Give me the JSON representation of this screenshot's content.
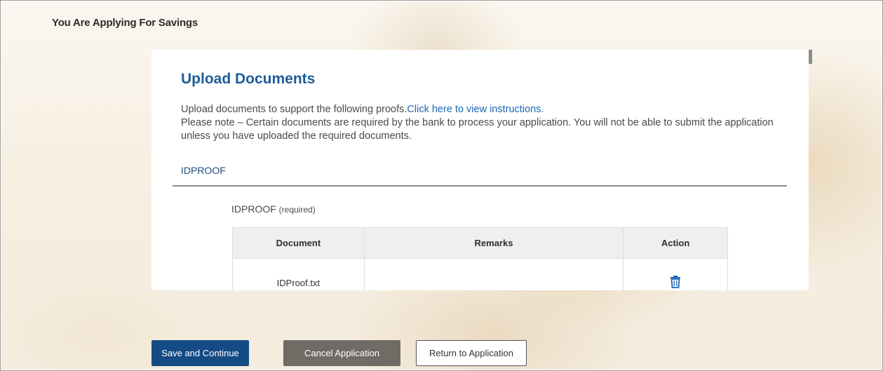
{
  "page": {
    "heading": "You Are Applying For Savings"
  },
  "upload": {
    "title": "Upload Documents",
    "intro_text": "Upload documents to support the following proofs.",
    "instructions_link": "Click here to view instructions.",
    "note": "Please note – Certain documents are required by the bank to process your application. You will not be able to submit the application unless you have uploaded the required documents."
  },
  "section": {
    "label": "IDPROOF",
    "proof_label": "IDPROOF",
    "required_tag": "(required)"
  },
  "table": {
    "headers": {
      "document": "Document",
      "remarks": "Remarks",
      "action": "Action"
    },
    "rows": [
      {
        "document": "IDProof.txt",
        "remarks": "",
        "action_icon": "trash-icon"
      }
    ]
  },
  "actions": {
    "save_continue": "Save and Continue",
    "cancel_application": "Cancel Application",
    "return_to_application": "Return to Application"
  },
  "colors": {
    "primary": "#154b85",
    "secondary": "#6f6c66",
    "title": "#1f5c99",
    "link": "#1b67b7",
    "icon": "#1b67b7"
  }
}
